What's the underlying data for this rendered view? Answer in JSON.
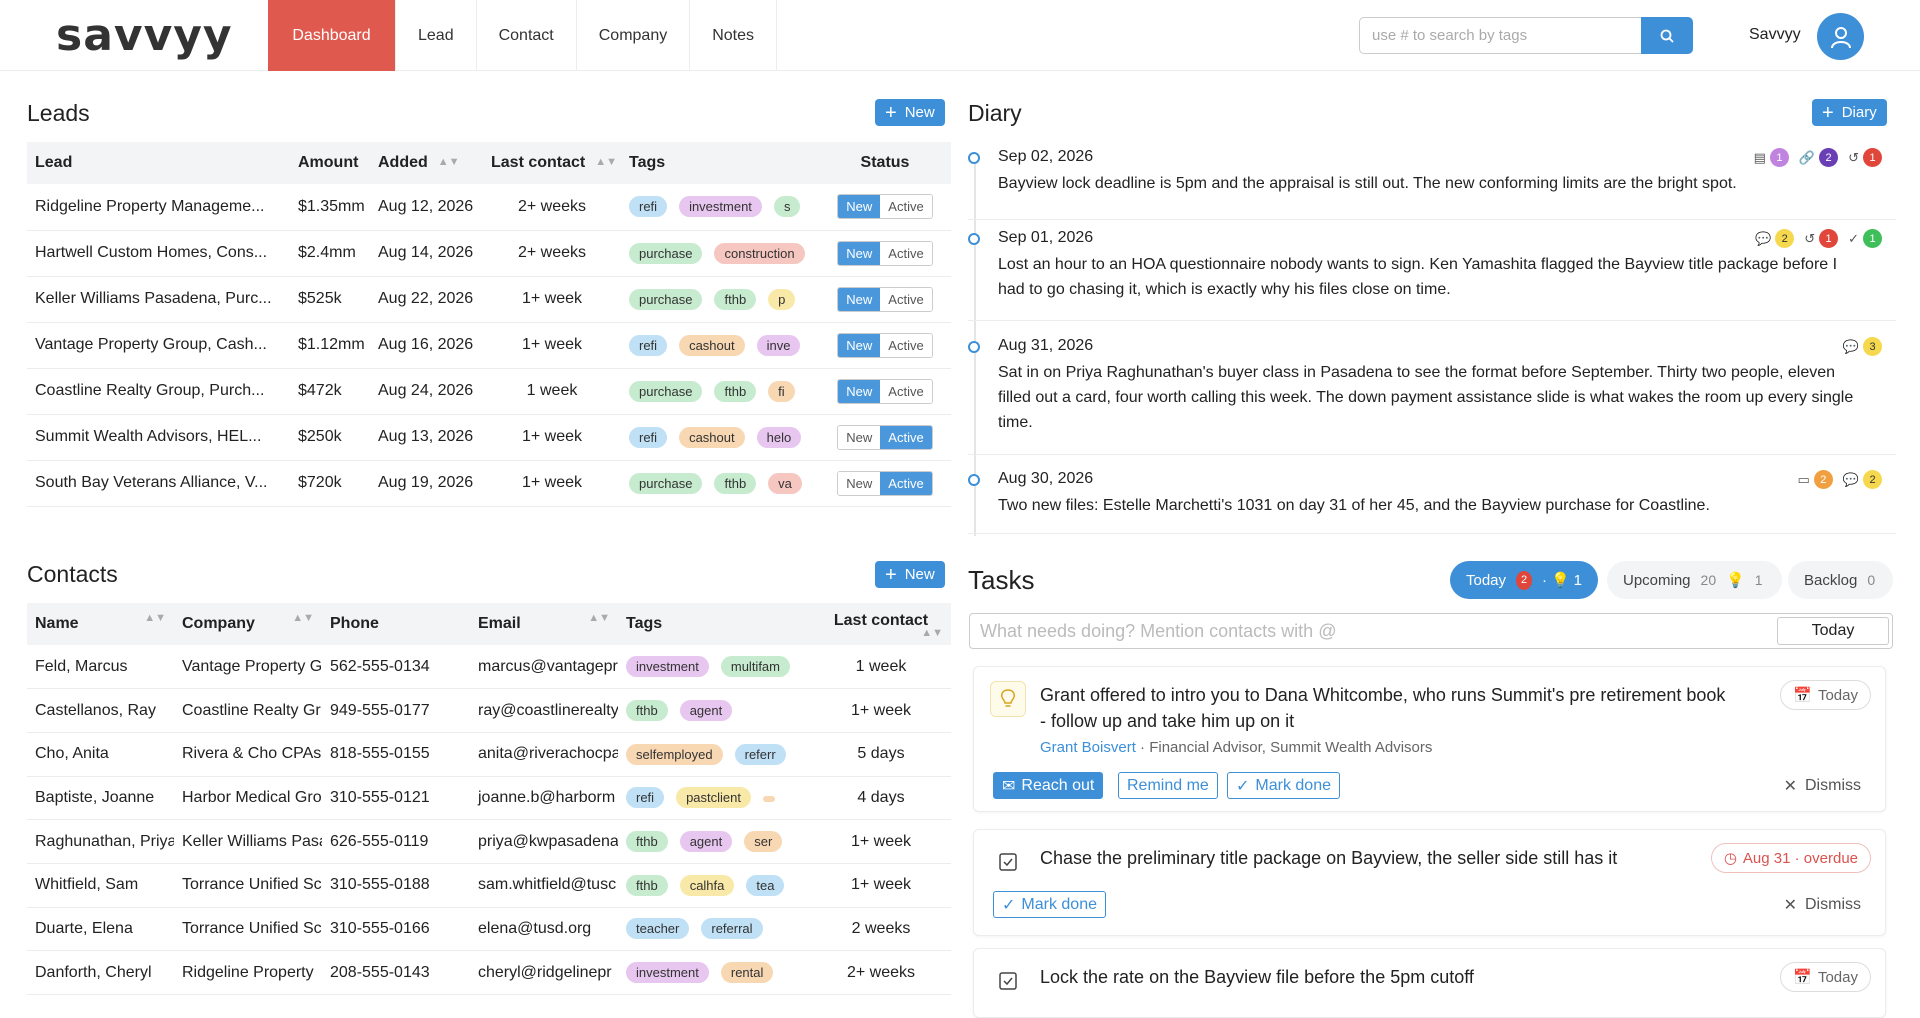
{
  "header": {
    "logo": "savvyy",
    "nav": [
      "Dashboard",
      "Lead",
      "Contact",
      "Company",
      "Notes"
    ],
    "search_placeholder": "use # to search by tags",
    "user_name": "Savvyy"
  },
  "leads": {
    "title": "Leads",
    "new_label": "New",
    "columns": [
      "Lead",
      "Amount",
      "Added",
      "Last contact",
      "Tags",
      "Status"
    ],
    "status_options": [
      "New",
      "Active"
    ],
    "rows": [
      {
        "lead": "Ridgeline Property Manageme...",
        "amount": "$1.35mm",
        "added": "Aug 12, 2026",
        "last": "2+ weeks",
        "tags": [
          "refi",
          "investment",
          "s"
        ],
        "status": "New"
      },
      {
        "lead": "Hartwell Custom Homes, Cons...",
        "amount": "$2.4mm",
        "added": "Aug 14, 2026",
        "last": "2+ weeks",
        "tags": [
          "purchase",
          "construction"
        ],
        "status": "New"
      },
      {
        "lead": "Keller Williams Pasadena, Purc...",
        "amount": "$525k",
        "added": "Aug 22, 2026",
        "last": "1+ week",
        "tags": [
          "purchase",
          "fthb",
          "p"
        ],
        "status": "New"
      },
      {
        "lead": "Vantage Property Group, Cash...",
        "amount": "$1.12mm",
        "added": "Aug 16, 2026",
        "last": "1+ week",
        "tags": [
          "refi",
          "cashout",
          "inve"
        ],
        "status": "New"
      },
      {
        "lead": "Coastline Realty Group, Purch...",
        "amount": "$472k",
        "added": "Aug 24, 2026",
        "last": "1 week",
        "tags": [
          "purchase",
          "fthb",
          "fi"
        ],
        "status": "New"
      },
      {
        "lead": "Summit Wealth Advisors, HEL...",
        "amount": "$250k",
        "added": "Aug 13, 2026",
        "last": "1+ week",
        "tags": [
          "refi",
          "cashout",
          "helo"
        ],
        "status": "Active"
      },
      {
        "lead": "South Bay Veterans Alliance, V...",
        "amount": "$720k",
        "added": "Aug 19, 2026",
        "last": "1+ week",
        "tags": [
          "purchase",
          "fthb",
          "va"
        ],
        "status": "Active"
      }
    ]
  },
  "contacts": {
    "title": "Contacts",
    "new_label": "New",
    "columns": [
      "Name",
      "Company",
      "Phone",
      "Email",
      "Tags",
      "Last contact"
    ],
    "rows": [
      {
        "name": "Feld, Marcus",
        "company": "Vantage Property G",
        "phone": "562-555-0134",
        "email": "marcus@vantagepr",
        "tags": [
          "investment",
          "multifam"
        ],
        "last": "1 week"
      },
      {
        "name": "Castellanos, Ray",
        "company": "Coastline Realty Gr",
        "phone": "949-555-0177",
        "email": "ray@coastlinerealty",
        "tags": [
          "fthb",
          "agent"
        ],
        "last": "1+ week"
      },
      {
        "name": "Cho, Anita",
        "company": "Rivera & Cho CPAs",
        "phone": "818-555-0155",
        "email": "anita@riverachocpa",
        "tags": [
          "selfemployed",
          "referr"
        ],
        "last": "5 days"
      },
      {
        "name": "Baptiste, Joanne",
        "company": "Harbor Medical Gro",
        "phone": "310-555-0121",
        "email": "joanne.b@harborm",
        "tags": [
          "refi",
          "pastclient",
          ""
        ],
        "last": "4 days"
      },
      {
        "name": "Raghunathan, Priya",
        "company": "Keller Williams Pasa",
        "phone": "626-555-0119",
        "email": "priya@kwpasadena",
        "tags": [
          "fthb",
          "agent",
          "ser"
        ],
        "last": "1+ week"
      },
      {
        "name": "Whitfield, Sam",
        "company": "Torrance Unified Sc",
        "phone": "310-555-0188",
        "email": "sam.whitfield@tusc",
        "tags": [
          "fthb",
          "calhfa",
          "tea"
        ],
        "last": "1+ week"
      },
      {
        "name": "Duarte, Elena",
        "company": "Torrance Unified Sc",
        "phone": "310-555-0166",
        "email": "elena@tusd.org",
        "tags": [
          "teacher",
          "referral"
        ],
        "last": "2 weeks"
      },
      {
        "name": "Danforth, Cheryl",
        "company": "Ridgeline Property",
        "phone": "208-555-0143",
        "email": "cheryl@ridgelinepr",
        "tags": [
          "investment",
          "rental"
        ],
        "last": "2+ weeks"
      }
    ]
  },
  "tag_colors": {
    "refi": "#bfe0f5",
    "investment": "#e7c6ef",
    "purchase": "#c6ebcf",
    "construction": "#f6c7c0",
    "fthb": "#c6ebcf",
    "cashout": "#f8d7b3",
    "helo": "#e7c6ef",
    "va": "#f6c7c0",
    "p": "#f9e9a8",
    "inve": "#e7c6ef",
    "fi": "#f8d7b3",
    "s": "#c6ebcf",
    "multifam": "#c6ebcf",
    "agent": "#e7c6ef",
    "selfemployed": "#f8d7b3",
    "referr": "#bfe0f5",
    "pastclient": "#f9e9a8",
    "ser": "#f8d7b3",
    "calhfa": "#f9e9a8",
    "tea": "#bfe0f5",
    "teacher": "#bfe0f5",
    "referral": "#bfe0f5",
    "rental": "#f8d7b3",
    "": "#f8d7b3"
  },
  "diary": {
    "title": "Diary",
    "new_label": "Diary",
    "entries": [
      {
        "date": "Sep 02, 2026",
        "text": "Bayview lock deadline is 5pm and the appraisal is still out. The new conforming limits are the bright spot.",
        "badges": [
          {
            "icon": "note-icon",
            "n": "1",
            "color": "#c084e0"
          },
          {
            "icon": "link-icon",
            "n": "2",
            "color": "#6a3fb5"
          },
          {
            "icon": "history-icon",
            "n": "1",
            "color": "#e0463a"
          }
        ]
      },
      {
        "date": "Sep 01, 2026",
        "text": "Lost an hour to an HOA questionnaire nobody wants to sign. Ken Yamashita flagged the Bayview title package before I had to go chasing it, which is exactly why his files close on time.",
        "badges": [
          {
            "icon": "comment-icon",
            "n": "2",
            "color": "#f6d84e"
          },
          {
            "icon": "history-icon",
            "n": "1",
            "color": "#e0463a"
          },
          {
            "icon": "check-icon",
            "n": "1",
            "color": "#3fbf5a"
          }
        ]
      },
      {
        "date": "Aug 31, 2026",
        "text": "Sat in on Priya Raghunathan's buyer class in Pasadena to see the format before September. Thirty two people, eleven filled out a card, four worth calling this week. The down payment assistance slide is what wakes the room up every single time.",
        "badges": [
          {
            "icon": "comment-icon",
            "n": "3",
            "color": "#f6d84e"
          }
        ]
      },
      {
        "date": "Aug 30, 2026",
        "text": "Two new files: Estelle Marchetti's 1031 on day 31 of her 45, and the Bayview purchase for Coastline.",
        "badges": [
          {
            "icon": "inbox-icon",
            "n": "2",
            "color": "#f0a040"
          },
          {
            "icon": "comment-icon",
            "n": "2",
            "color": "#f6d84e"
          }
        ]
      }
    ]
  },
  "tasks": {
    "title": "Tasks",
    "tabs": [
      {
        "label": "Today",
        "count": "2",
        "ideas": "1"
      },
      {
        "label": "Upcoming",
        "count": "20",
        "ideas": "1"
      },
      {
        "label": "Backlog",
        "count": "0"
      }
    ],
    "input_placeholder": "What needs doing? Mention contacts with @",
    "today_button": "Today",
    "items": [
      {
        "text_line1": "Grant offered to intro you to Dana Whitcombe, who runs Summit's pre retirement book",
        "text_line2": "- follow up and take him up on it",
        "contact": "Grant Boisvert",
        "contact_meta": " · Financial Advisor, Summit Wealth Advisors",
        "date": "Today",
        "actions": [
          "Reach out",
          "Remind me",
          "Mark done"
        ],
        "dismiss": "Dismiss"
      },
      {
        "text_line1": "Chase the preliminary title package on Bayview, the seller side still has it",
        "date": "Aug 31 · overdue",
        "actions": [
          "Mark done"
        ],
        "dismiss": "Dismiss"
      },
      {
        "text_line1": "Lock the rate on the Bayview file before the 5pm cutoff",
        "date": "Today"
      }
    ]
  }
}
